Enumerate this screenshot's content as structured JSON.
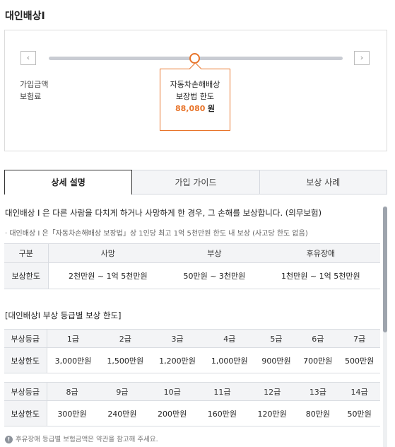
{
  "page": {
    "title": "대인배상I"
  },
  "slider": {
    "prev_icon": "‹",
    "next_icon": "›",
    "labels": [
      "가입금액",
      "보험료"
    ],
    "level_fraction": 0.5,
    "tooltip": {
      "line1": "자동차손해배상",
      "line2": "보장법 한도",
      "amount": "88,080",
      "unit": "원"
    }
  },
  "tabs": [
    {
      "label": "상세 설명",
      "active": true
    },
    {
      "label": "가입 가이드",
      "active": false
    },
    {
      "label": "보상 사례",
      "active": false
    }
  ],
  "content": {
    "description": "대인배상 Ⅰ 은 다른 사람을 다치게 하거나 사망하게 한 경우, 그 손해를 보상합니다. (의무보험)",
    "sub_description": "· 대인배상 Ⅰ 은「자동차손해배상 보장법」상 1인당 최고 1억 5천만원 한도 내 보상 (사고당 한도 없음)",
    "limit_table": {
      "headers": [
        "구분",
        "사망",
        "부상",
        "후유장애"
      ],
      "row": [
        "보상한도",
        "2천만원 ~ 1억 5천만원",
        "50만원 ~ 3천만원",
        "1천만원 ~ 1억 5천만원"
      ]
    },
    "grade_section_title": "[대인배상I 부상 등급별 보상 한도]",
    "grade_table_1": {
      "headers": [
        "부상등급",
        "1급",
        "2급",
        "3급",
        "4급",
        "5급",
        "6급",
        "7급"
      ],
      "row": [
        "보상한도",
        "3,000만원",
        "1,500만원",
        "1,200만원",
        "1,000만원",
        "900만원",
        "700만원",
        "500만원"
      ]
    },
    "grade_table_2": {
      "headers": [
        "부상등급",
        "8급",
        "9급",
        "10급",
        "11급",
        "12급",
        "13급",
        "14급"
      ],
      "row": [
        "보상한도",
        "300만원",
        "240만원",
        "200만원",
        "160만원",
        "120만원",
        "80만원",
        "50만원"
      ]
    },
    "note": "후유장애 등급별 보험금액은 약관을 참고해 주세요.",
    "note_icon": "!"
  },
  "colors": {
    "accent": "#e8742a",
    "track": "#c9ccd3",
    "table_header": "#f3f4f6"
  }
}
